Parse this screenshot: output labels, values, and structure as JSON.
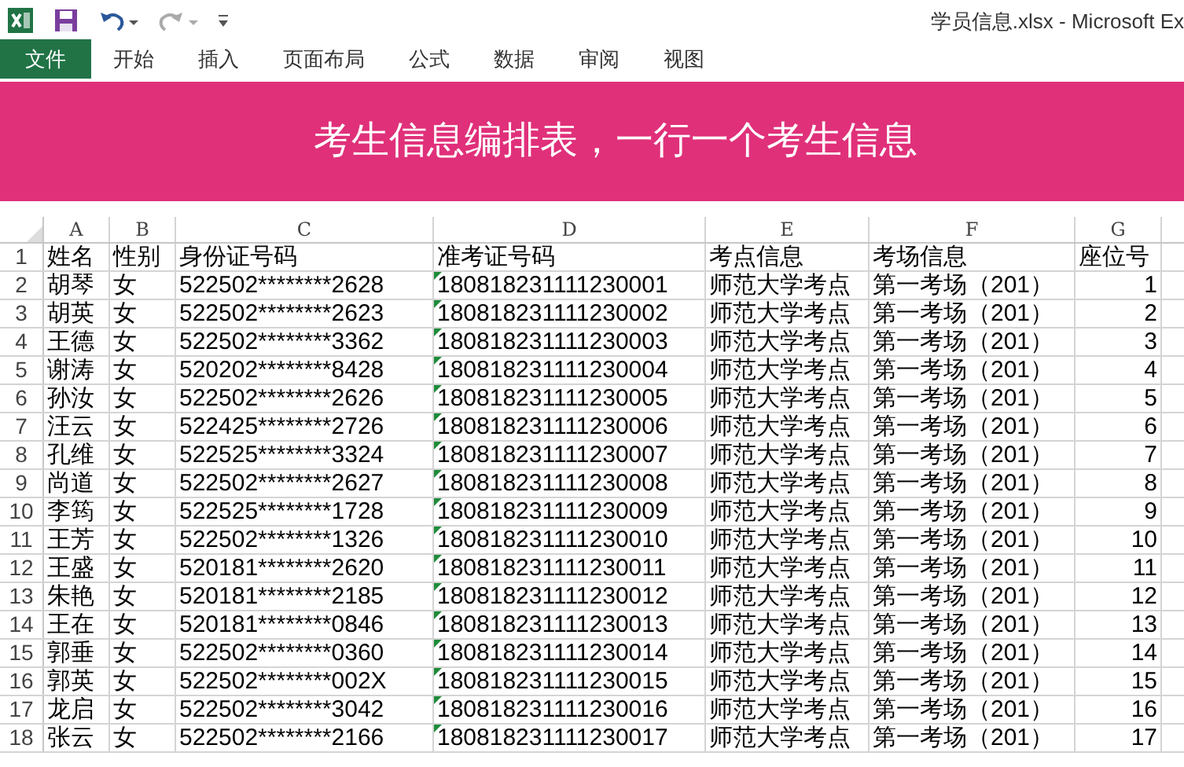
{
  "window": {
    "title": "学员信息.xlsx - Microsoft Ex"
  },
  "ribbon_tabs": [
    {
      "label": "文件",
      "kind": "file",
      "selected": false
    },
    {
      "label": "开始",
      "kind": "tab",
      "selected": false
    },
    {
      "label": "插入",
      "kind": "tab",
      "selected": false
    },
    {
      "label": "页面布局",
      "kind": "tab",
      "selected": false
    },
    {
      "label": "公式",
      "kind": "tab",
      "selected": false
    },
    {
      "label": "数据",
      "kind": "tab",
      "selected": false
    },
    {
      "label": "审阅",
      "kind": "tab",
      "selected": false
    },
    {
      "label": "视图",
      "kind": "tab",
      "selected": false
    }
  ],
  "banner": {
    "text": "考生信息编排表，一行一个考生信息"
  },
  "sheet": {
    "columns": [
      "A",
      "B",
      "C",
      "D",
      "E",
      "F",
      "G"
    ],
    "rows": [
      {
        "number": "1",
        "cells": [
          "姓名",
          "性别",
          "身份证号码",
          "准考证号码",
          "考点信息",
          "考场信息",
          "座位号"
        ],
        "flagged": false
      },
      {
        "number": "2",
        "cells": [
          "胡琴",
          "女",
          "522502********2628",
          "180818231111230001",
          "师范大学考点",
          "第一考场（201）",
          "1"
        ],
        "flagged": true
      },
      {
        "number": "3",
        "cells": [
          "胡英",
          "女",
          "522502********2623",
          "180818231111230002",
          "师范大学考点",
          "第一考场（201）",
          "2"
        ],
        "flagged": true
      },
      {
        "number": "4",
        "cells": [
          "王德",
          "女",
          "522502********3362",
          "180818231111230003",
          "师范大学考点",
          "第一考场（201）",
          "3"
        ],
        "flagged": true
      },
      {
        "number": "5",
        "cells": [
          "谢涛",
          "女",
          "520202********8428",
          "180818231111230004",
          "师范大学考点",
          "第一考场（201）",
          "4"
        ],
        "flagged": true
      },
      {
        "number": "6",
        "cells": [
          "孙汝",
          "女",
          "522502********2626",
          "180818231111230005",
          "师范大学考点",
          "第一考场（201）",
          "5"
        ],
        "flagged": true
      },
      {
        "number": "7",
        "cells": [
          "汪云",
          "女",
          "522425********2726",
          "180818231111230006",
          "师范大学考点",
          "第一考场（201）",
          "6"
        ],
        "flagged": true
      },
      {
        "number": "8",
        "cells": [
          "孔维",
          "女",
          "522525********3324",
          "180818231111230007",
          "师范大学考点",
          "第一考场（201）",
          "7"
        ],
        "flagged": true
      },
      {
        "number": "9",
        "cells": [
          "尚道",
          "女",
          "522502********2627",
          "180818231111230008",
          "师范大学考点",
          "第一考场（201）",
          "8"
        ],
        "flagged": true
      },
      {
        "number": "10",
        "cells": [
          "李筠",
          "女",
          "522525********1728",
          "180818231111230009",
          "师范大学考点",
          "第一考场（201）",
          "9"
        ],
        "flagged": true
      },
      {
        "number": "11",
        "cells": [
          "王芳",
          "女",
          "522502********1326",
          "180818231111230010",
          "师范大学考点",
          "第一考场（201）",
          "10"
        ],
        "flagged": true
      },
      {
        "number": "12",
        "cells": [
          "王盛",
          "女",
          "520181********2620",
          "180818231111230011",
          "师范大学考点",
          "第一考场（201）",
          "11"
        ],
        "flagged": true
      },
      {
        "number": "13",
        "cells": [
          "朱艳",
          "女",
          "520181********2185",
          "180818231111230012",
          "师范大学考点",
          "第一考场（201）",
          "12"
        ],
        "flagged": true
      },
      {
        "number": "14",
        "cells": [
          "王在",
          "女",
          "520181********0846",
          "180818231111230013",
          "师范大学考点",
          "第一考场（201）",
          "13"
        ],
        "flagged": true
      },
      {
        "number": "15",
        "cells": [
          "郭垂",
          "女",
          "522502********0360",
          "180818231111230014",
          "师范大学考点",
          "第一考场（201）",
          "14"
        ],
        "flagged": true
      },
      {
        "number": "16",
        "cells": [
          "郭英",
          "女",
          "522502********002X",
          "180818231111230015",
          "师范大学考点",
          "第一考场（201）",
          "15"
        ],
        "flagged": true
      },
      {
        "number": "17",
        "cells": [
          "龙启",
          "女",
          "522502********3042",
          "180818231111230016",
          "师范大学考点",
          "第一考场（201）",
          "16"
        ],
        "flagged": true
      },
      {
        "number": "18",
        "cells": [
          "张云",
          "女",
          "522502********2166",
          "180818231111230017",
          "师范大学考点",
          "第一考场（201）",
          "17"
        ],
        "flagged": true
      }
    ]
  }
}
